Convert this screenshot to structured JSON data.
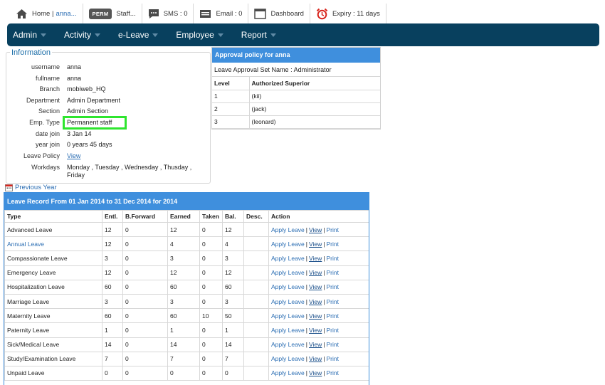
{
  "topbar": {
    "home_label": "Home |",
    "home_user": "anna...",
    "perm_badge": "PERM",
    "staff_label": "Staff...",
    "sms_label": "SMS : 0",
    "email_label": "Email : 0",
    "dashboard_label": "Dashboard",
    "expiry_label": "Expiry : 11 days"
  },
  "nav": [
    "Admin",
    "Activity",
    "e-Leave",
    "Employee",
    "Report"
  ],
  "info": {
    "legend": "Information",
    "rows": [
      {
        "label": "username",
        "value": "anna"
      },
      {
        "label": "fullname",
        "value": "anna"
      },
      {
        "label": "Branch",
        "value": "mobiweb_HQ"
      },
      {
        "label": "Department",
        "value": "Admin Department"
      },
      {
        "label": "Section",
        "value": "Admin Section"
      },
      {
        "label": "Emp. Type",
        "value": "Permanent staff"
      },
      {
        "label": "date join",
        "value": "3 Jan 14"
      },
      {
        "label": "year join",
        "value": "0 years 45 days"
      },
      {
        "label": "Leave Policy",
        "value": "View"
      },
      {
        "label": "Workdays",
        "value": "Monday , Tuesday , Wednesday , Thusday , Friday"
      }
    ]
  },
  "approval": {
    "title": "Approval policy for anna",
    "set_name": "Leave Approval Set Name : Administrator",
    "col_level": "Level",
    "col_superior": "Authorized Superior",
    "rows": [
      {
        "level": "1",
        "superior": "(kii)"
      },
      {
        "level": "2",
        "superior": "(jack)"
      },
      {
        "level": "3",
        "superior": "(leonard)"
      }
    ]
  },
  "previous_year": "Previous Year",
  "record": {
    "title": "Leave Record From 01 Jan 2014 to 31 Dec 2014 for 2014",
    "columns": [
      "Type",
      "Entl.",
      "B.Forward",
      "Earned",
      "Taken",
      "Bal.",
      "Desc.",
      "Action"
    ],
    "action_apply": "Apply Leave",
    "action_view": "View",
    "action_print": "Print",
    "action_sep": "|",
    "rows": [
      {
        "type": "Advanced Leave",
        "entl": "12",
        "bf": "0",
        "earned": "12",
        "taken": "0",
        "bal": "12"
      },
      {
        "type": "Annual Leave",
        "entl": "12",
        "bf": "0",
        "earned": "4",
        "taken": "0",
        "bal": "4"
      },
      {
        "type": "Compassionate Leave",
        "entl": "3",
        "bf": "0",
        "earned": "3",
        "taken": "0",
        "bal": "3"
      },
      {
        "type": "Emergency Leave",
        "entl": "12",
        "bf": "0",
        "earned": "12",
        "taken": "0",
        "bal": "12"
      },
      {
        "type": "Hospitalization Leave",
        "entl": "60",
        "bf": "0",
        "earned": "60",
        "taken": "0",
        "bal": "60"
      },
      {
        "type": "Marriage Leave",
        "entl": "3",
        "bf": "0",
        "earned": "3",
        "taken": "0",
        "bal": "3"
      },
      {
        "type": "Maternity Leave",
        "entl": "60",
        "bf": "0",
        "earned": "60",
        "taken": "10",
        "bal": "50"
      },
      {
        "type": "Paternity Leave",
        "entl": "1",
        "bf": "0",
        "earned": "1",
        "taken": "0",
        "bal": "1"
      },
      {
        "type": "Sick/Medical Leave",
        "entl": "14",
        "bf": "0",
        "earned": "14",
        "taken": "0",
        "bal": "14"
      },
      {
        "type": "Study/Examination Leave",
        "entl": "7",
        "bf": "0",
        "earned": "7",
        "taken": "0",
        "bal": "7"
      },
      {
        "type": "Unpaid Leave",
        "entl": "0",
        "bf": "0",
        "earned": "0",
        "taken": "0",
        "bal": "0"
      }
    ]
  },
  "colors": {
    "nav_bg": "#08405e",
    "header_blue": "#3f8fdd",
    "link_blue": "#2a6db3",
    "highlight_green": "#2ee52e"
  }
}
